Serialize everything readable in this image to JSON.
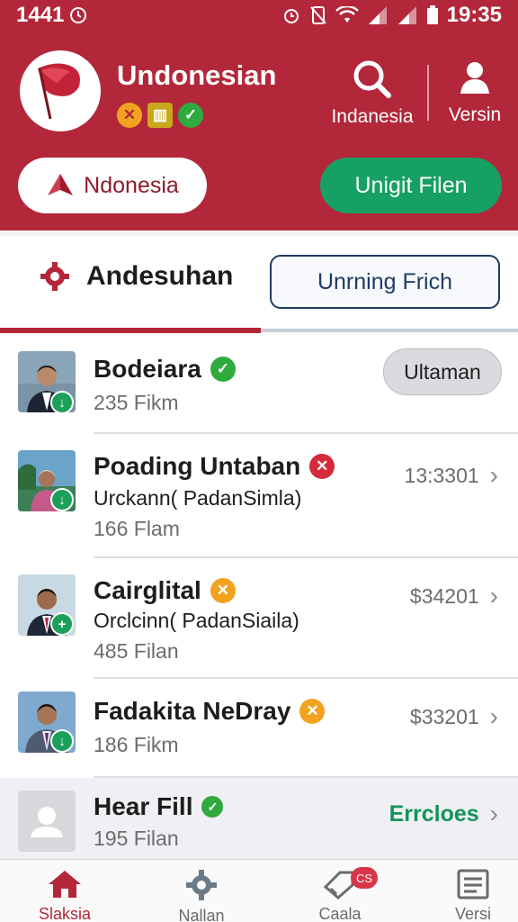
{
  "status_bar": {
    "left_text": "1441",
    "time": "19:35"
  },
  "header": {
    "title": "Undonesian",
    "search_label": "Indanesia",
    "profile_label": "Versin",
    "country_pill": "Ndonesia",
    "action_pill": "Unigit Filen"
  },
  "tabs": {
    "active_label": "Andesuhan",
    "outline_label": "Unrning Frich"
  },
  "list": [
    {
      "name": "Bodeiara",
      "status": "verified",
      "sub": "",
      "meta": "235 Fikm",
      "right": "Ultaman",
      "right_type": "pill"
    },
    {
      "name": "Poading Untaban",
      "status": "rejected",
      "sub": "Urckann( PadanSimla)",
      "meta": "166 Flam",
      "right": "13:3301",
      "right_type": "value"
    },
    {
      "name": "Cairglital",
      "status": "pending",
      "sub": "Orclcinn( PadanSiaila)",
      "meta": "485 Filan",
      "right": "$34201",
      "right_type": "value"
    },
    {
      "name": "Fadakita NeDray",
      "status": "pending",
      "sub": "",
      "meta": "186 Fikm",
      "right": "$33201",
      "right_type": "value"
    },
    {
      "name": "Hear Fill",
      "status": "verified",
      "sub": "",
      "meta": "195 Filan",
      "right": "Errcloes",
      "right_type": "green"
    }
  ],
  "bottom_nav": [
    {
      "label": "Slaksia",
      "icon": "home-icon"
    },
    {
      "label": "Nallan",
      "icon": "gear-icon"
    },
    {
      "label": "Caala",
      "icon": "tag-icon",
      "badge": "CS"
    },
    {
      "label": "Versi",
      "icon": "list-icon"
    }
  ],
  "colors": {
    "brand": "#b3273a",
    "accent_green": "#16a063",
    "verified": "#2eaa3f",
    "rejected": "#d42a3a",
    "pending": "#f1a320"
  }
}
